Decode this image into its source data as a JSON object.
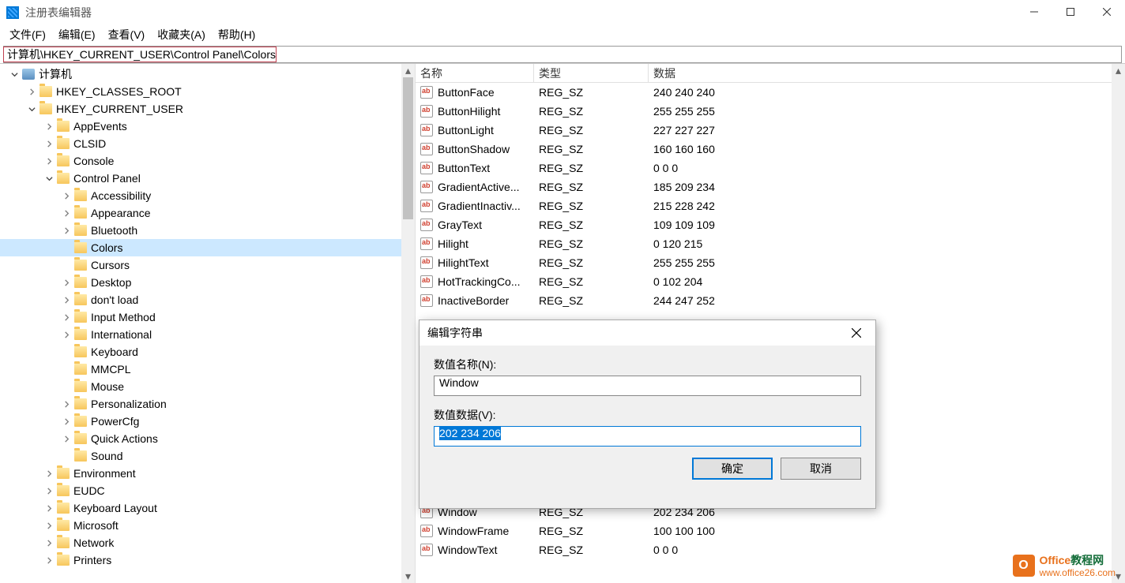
{
  "window": {
    "title": "注册表编辑器"
  },
  "menubar": {
    "file": "文件(F)",
    "edit": "编辑(E)",
    "view": "查看(V)",
    "favorites": "收藏夹(A)",
    "help": "帮助(H)"
  },
  "address": "计算机\\HKEY_CURRENT_USER\\Control Panel\\Colors",
  "tree": [
    {
      "depth": 0,
      "exp": "open",
      "icon": "pc",
      "label": "计算机"
    },
    {
      "depth": 1,
      "exp": "closed",
      "icon": "folder",
      "label": "HKEY_CLASSES_ROOT"
    },
    {
      "depth": 1,
      "exp": "open",
      "icon": "folder",
      "label": "HKEY_CURRENT_USER"
    },
    {
      "depth": 2,
      "exp": "closed",
      "icon": "folder",
      "label": "AppEvents"
    },
    {
      "depth": 2,
      "exp": "closed",
      "icon": "folder",
      "label": "CLSID"
    },
    {
      "depth": 2,
      "exp": "closed",
      "icon": "folder",
      "label": "Console"
    },
    {
      "depth": 2,
      "exp": "open",
      "icon": "folder",
      "label": "Control Panel"
    },
    {
      "depth": 3,
      "exp": "closed",
      "icon": "folder",
      "label": "Accessibility"
    },
    {
      "depth": 3,
      "exp": "closed",
      "icon": "folder",
      "label": "Appearance"
    },
    {
      "depth": 3,
      "exp": "closed",
      "icon": "folder",
      "label": "Bluetooth"
    },
    {
      "depth": 3,
      "exp": "none",
      "icon": "folder",
      "label": "Colors",
      "selected": true
    },
    {
      "depth": 3,
      "exp": "none",
      "icon": "folder",
      "label": "Cursors"
    },
    {
      "depth": 3,
      "exp": "closed",
      "icon": "folder",
      "label": "Desktop"
    },
    {
      "depth": 3,
      "exp": "closed",
      "icon": "folder",
      "label": "don't load"
    },
    {
      "depth": 3,
      "exp": "closed",
      "icon": "folder",
      "label": "Input Method"
    },
    {
      "depth": 3,
      "exp": "closed",
      "icon": "folder",
      "label": "International"
    },
    {
      "depth": 3,
      "exp": "none",
      "icon": "folder",
      "label": "Keyboard"
    },
    {
      "depth": 3,
      "exp": "none",
      "icon": "folder",
      "label": "MMCPL"
    },
    {
      "depth": 3,
      "exp": "none",
      "icon": "folder",
      "label": "Mouse"
    },
    {
      "depth": 3,
      "exp": "closed",
      "icon": "folder",
      "label": "Personalization"
    },
    {
      "depth": 3,
      "exp": "closed",
      "icon": "folder",
      "label": "PowerCfg"
    },
    {
      "depth": 3,
      "exp": "closed",
      "icon": "folder",
      "label": "Quick Actions"
    },
    {
      "depth": 3,
      "exp": "none",
      "icon": "folder",
      "label": "Sound"
    },
    {
      "depth": 2,
      "exp": "closed",
      "icon": "folder",
      "label": "Environment"
    },
    {
      "depth": 2,
      "exp": "closed",
      "icon": "folder",
      "label": "EUDC"
    },
    {
      "depth": 2,
      "exp": "closed",
      "icon": "folder",
      "label": "Keyboard Layout"
    },
    {
      "depth": 2,
      "exp": "closed",
      "icon": "folder",
      "label": "Microsoft"
    },
    {
      "depth": 2,
      "exp": "closed",
      "icon": "folder",
      "label": "Network"
    },
    {
      "depth": 2,
      "exp": "closed",
      "icon": "folder",
      "label": "Printers"
    }
  ],
  "list": {
    "headers": {
      "name": "名称",
      "type": "类型",
      "data": "数据"
    },
    "rows_top": [
      {
        "name": "ButtonFace",
        "type": "REG_SZ",
        "data": "240 240 240"
      },
      {
        "name": "ButtonHilight",
        "type": "REG_SZ",
        "data": "255 255 255"
      },
      {
        "name": "ButtonLight",
        "type": "REG_SZ",
        "data": "227 227 227"
      },
      {
        "name": "ButtonShadow",
        "type": "REG_SZ",
        "data": "160 160 160"
      },
      {
        "name": "ButtonText",
        "type": "REG_SZ",
        "data": "0 0 0"
      },
      {
        "name": "GradientActive...",
        "type": "REG_SZ",
        "data": "185 209 234"
      },
      {
        "name": "GradientInactiv...",
        "type": "REG_SZ",
        "data": "215 228 242"
      },
      {
        "name": "GrayText",
        "type": "REG_SZ",
        "data": "109 109 109"
      },
      {
        "name": "Hilight",
        "type": "REG_SZ",
        "data": "0 120 215"
      },
      {
        "name": "HilightText",
        "type": "REG_SZ",
        "data": "255 255 255"
      },
      {
        "name": "HotTrackingCo...",
        "type": "REG_SZ",
        "data": "0 102 204"
      },
      {
        "name": "InactiveBorder",
        "type": "REG_SZ",
        "data": "244 247 252"
      }
    ],
    "rows_bottom": [
      {
        "name": "Window",
        "type": "REG_SZ",
        "data": "202 234 206"
      },
      {
        "name": "WindowFrame",
        "type": "REG_SZ",
        "data": "100 100 100"
      },
      {
        "name": "WindowText",
        "type": "REG_SZ",
        "data": "0 0 0"
      }
    ]
  },
  "dialog": {
    "title": "编辑字符串",
    "name_label": "数值名称(N):",
    "name_value": "Window",
    "data_label": "数值数据(V):",
    "data_value": "202 234 206",
    "ok": "确定",
    "cancel": "取消"
  },
  "watermark": {
    "brand1": "Office",
    "brand2": "教程网",
    "url": "www.office26.com"
  }
}
